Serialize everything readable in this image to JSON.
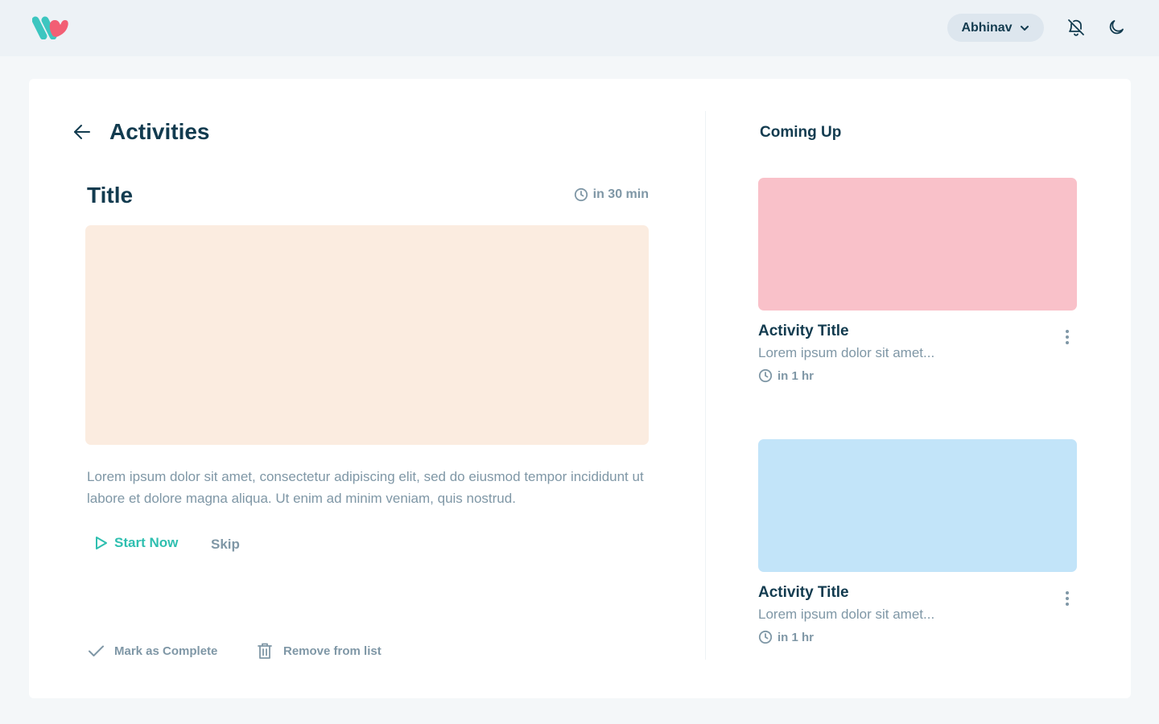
{
  "topbar": {
    "user_name": "Abhinav",
    "icons": {
      "logo": "brand-logo",
      "bell": "bell-off-icon",
      "moon": "moon-icon",
      "chevron": "chevron-down-icon"
    }
  },
  "activity": {
    "page_title": "Activities",
    "title": "Title",
    "time": "in 30 min",
    "description": "Lorem ipsum dolor sit amet, consectetur adipiscing elit, sed do eiusmod tempor incididunt ut labore et dolore magna aliqua. Ut enim ad minim veniam, quis nostrud.",
    "start_label": "Start Now",
    "skip_label": "Skip",
    "mark_complete_label": "Mark as Complete",
    "remove_label": "Remove from list",
    "hero_color": "#fbece0"
  },
  "coming_up": {
    "title": "Coming Up",
    "items": [
      {
        "title": "Activity Title",
        "subtitle": "Lorem ipsum dolor sit amet...",
        "time": "in 1 hr",
        "color": "#f9c1c9"
      },
      {
        "title": "Activity Title",
        "subtitle": "Lorem ipsum dolor sit amet...",
        "time": "in 1 hr",
        "color": "#c2e4f9"
      }
    ]
  },
  "colors": {
    "accent": "#2fbfb0",
    "brand_pink": "#f25f74",
    "brand_teal": "#3cc6c0",
    "text_dark": "#123b4f",
    "text_muted": "#7f97a6"
  }
}
